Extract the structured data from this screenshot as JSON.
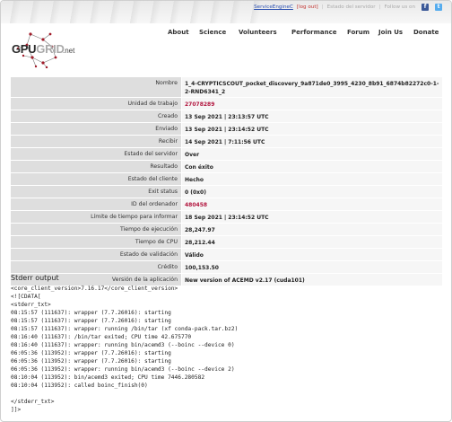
{
  "topbar": {
    "user_link": "ServiceEngineC",
    "logout": "[log out]",
    "separator": "|",
    "server_status": "Estado del servidor",
    "follow": "Follow us on",
    "facebook_glyph": "f",
    "twitter_glyph": "t"
  },
  "logo": {
    "part1": "GPU",
    "part2": "GRID",
    "suffix": ".net"
  },
  "nav": {
    "items": [
      "About",
      "Science",
      "Volunteers",
      "Performance",
      "Forum",
      "Join Us",
      "Donate"
    ]
  },
  "task": {
    "rows": [
      {
        "label": "Nombre",
        "value": "1_4-CRYPTICSCOUT_pocket_discovery_9a871de0_3995_4230_8b91_6874b82272c0-1-2-RND6341_2",
        "link": false
      },
      {
        "label": "Unidad de trabajo",
        "value": "27078289",
        "link": true
      },
      {
        "label": "Creado",
        "value": "13 Sep 2021 | 23:13:57 UTC",
        "link": false
      },
      {
        "label": "Enviado",
        "value": "13 Sep 2021 | 23:14:52 UTC",
        "link": false
      },
      {
        "label": "Recibir",
        "value": "14 Sep 2021 | 7:11:56 UTC",
        "link": false
      },
      {
        "label": "Estado del servidor",
        "value": "Over",
        "link": false
      },
      {
        "label": "Resultado",
        "value": "Con éxito",
        "link": false
      },
      {
        "label": "Estado del cliente",
        "value": "Hecho",
        "link": false
      },
      {
        "label": "Exit status",
        "value": "0 (0x0)",
        "link": false
      },
      {
        "label": "ID del ordenador",
        "value": "480458",
        "link": true
      },
      {
        "label": "Límite de tiempo para informar",
        "value": "18 Sep 2021 | 23:14:52 UTC",
        "link": false
      },
      {
        "label": "Tiempo de ejecución",
        "value": "28,247.97",
        "link": false
      },
      {
        "label": "Tiempo de CPU",
        "value": "28,212.44",
        "link": false
      },
      {
        "label": "Estado de validación",
        "value": "Válido",
        "link": false
      },
      {
        "label": "Crédito",
        "value": "100,153.50",
        "link": false
      },
      {
        "label": "Versión de la aplicación",
        "value": "New version of ACEMD v2.17 (cuda101)",
        "link": false
      }
    ]
  },
  "stderr": {
    "title": "Stderr output",
    "lines": [
      "<core_client_version>7.16.17</core_client_version>",
      "<![CDATA[",
      "<stderr_txt>",
      "08:15:57 (111637): wrapper (7.7.26016): starting",
      "08:15:57 (111637): wrapper (7.7.26016): starting",
      "08:15:57 (111637): wrapper: running /bin/tar (xf conda-pack.tar.bz2)",
      "08:16:40 (111637): /bin/tar exited; CPU time 42.675770",
      "08:16:40 (111637): wrapper: running bin/acemd3 (--boinc --device 0)",
      "06:05:36 (113952): wrapper (7.7.26016): starting",
      "06:05:36 (113952): wrapper (7.7.26016): starting",
      "06:05:36 (113952): wrapper: running bin/acemd3 (--boinc --device 2)",
      "08:10:04 (113952): bin/acemd3 exited; CPU time 7446.280582",
      "08:10:04 (113952): called boinc_finish(0)",
      "",
      "</stderr_txt>",
      "]]>"
    ]
  },
  "colors": {
    "link_red": "#b2153e",
    "label_bg": "#dedede",
    "value_bg": "#f6f6f6",
    "user_link": "#2a4fb0"
  }
}
